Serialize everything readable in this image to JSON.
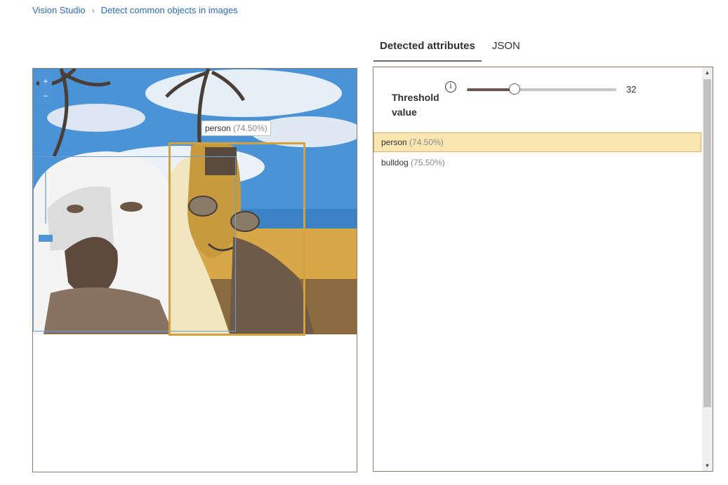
{
  "breadcrumb": {
    "home": "Vision Studio",
    "separator": "›",
    "current": "Detect common objects in images"
  },
  "tabs": [
    {
      "label": "Detected attributes",
      "active": true
    },
    {
      "label": "JSON",
      "active": false
    }
  ],
  "image_viewer": {
    "zoom_in": "+",
    "zoom_out": "−",
    "detection_label": {
      "name": "person",
      "confidence": "(74.50%)"
    }
  },
  "threshold": {
    "label": "Threshold value",
    "info_icon": "i",
    "value": "32",
    "level_percent": 32
  },
  "attributes": [
    {
      "name": "person",
      "confidence": "(74.50%)",
      "selected": true
    },
    {
      "name": "bulldog",
      "confidence": "(75.50%)",
      "selected": false
    }
  ],
  "colors": {
    "accent_link": "#2b6cb0",
    "selected_box": "#d4a23c",
    "other_box": "#6aa0d8",
    "selected_row": "#f9e6b2"
  },
  "icons": {
    "zoom_in": "zoom-in-icon",
    "zoom_out": "zoom-out-icon",
    "info": "info-icon",
    "scroll_up": "scroll-up-arrow-icon",
    "scroll_down": "scroll-down-arrow-icon"
  }
}
